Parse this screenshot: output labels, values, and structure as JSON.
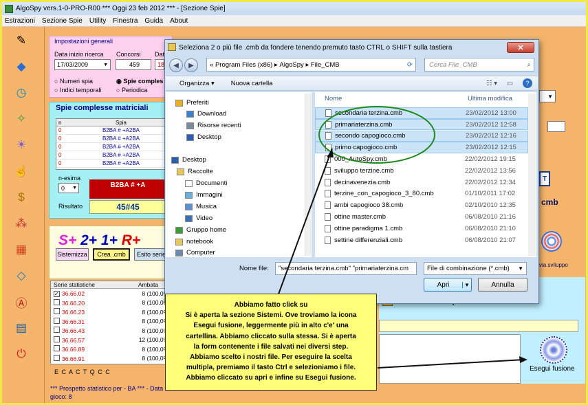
{
  "window": {
    "title": "AlgoSpy vers.1-0-PRO-R00  ***  Oggi 23 feb 2012  ***  - [Sezione Spie]"
  },
  "menu": [
    "Estrazioni",
    "Sezione Spie",
    "Utility",
    "Finestra",
    "Guida",
    "About"
  ],
  "toolbar_icons": [
    "pencil-icon",
    "book-icon",
    "clock-icon",
    "tag-icon",
    "bulb-icon",
    "hand-icon",
    "dollar-icon",
    "dots-icon",
    "calendar-icon",
    "diamond-icon",
    "a-icon",
    "notebook-icon",
    "power-icon"
  ],
  "settings": {
    "title": "Impostazioni generali",
    "date_label": "Data inizio ricerca",
    "date_value": "17/03/2009",
    "concorsi_label": "Concorsi",
    "concorsi_value": "459",
    "dat_label": "Dat",
    "dat_value": "18",
    "radio_numeri": "Numeri spia",
    "radio_spie": "Spie comples",
    "radio_indici": "Indici temporali",
    "radio_periodica": "Periodica"
  },
  "matrix": {
    "title": "Spie complesse matriciali",
    "col_n": "n",
    "col_spia": "Spia",
    "rows": [
      {
        "n": "0",
        "spia": "B2BA # +A2BA"
      },
      {
        "n": "0",
        "spia": "B2BA # +A2BA"
      },
      {
        "n": "0",
        "spia": "B2BA # +A2BA"
      },
      {
        "n": "0",
        "spia": "B2BA # +A2BA"
      },
      {
        "n": "0",
        "spia": "B2BA # +A2BA"
      }
    ],
    "nesima_label": "n-esima",
    "nesima_value": "0",
    "red_value": "B2BA # +A",
    "risultato_label": "Risultato",
    "risultato_value": "45#45"
  },
  "formula": {
    "s": "S+",
    "n2": "2+",
    "n1": "1+",
    "r": "R+"
  },
  "buttons": {
    "sistemizza": "Sistemizza",
    "crea": "Crea .cmb",
    "esito": "Esito serie"
  },
  "stats": {
    "col_serie": "Serie statistiche",
    "col_ambata": "Ambata",
    "rows": [
      {
        "serie": "36.66.02",
        "ambata": "8 (100,0%)",
        "checked": true
      },
      {
        "serie": "36.66.20",
        "ambata": "8 (100,0%)",
        "checked": false
      },
      {
        "serie": "36.66.23",
        "ambata": "8 (100,0%)",
        "checked": false
      },
      {
        "serie": "36.66.31",
        "ambata": "8 (100,0%)",
        "checked": false
      },
      {
        "serie": "36.66.43",
        "ambata": "8 (100,0%)",
        "checked": false
      },
      {
        "serie": "36.66.57",
        "ambata": "12 (100,0%)",
        "checked": false
      },
      {
        "serie": "36.66.89",
        "ambata": "8 (100,0%)",
        "checked": false
      },
      {
        "serie": "36.66.91",
        "ambata": "8 (100,0%)",
        "checked": false
      }
    ],
    "radios": "E C A C T Q C C",
    "footer1": "*** Prospetto statistico per  - BA ***  - Data i",
    "footer2": "gioco: 8"
  },
  "right": {
    "cmb_label": "cmb",
    "sviluppo_label": "via sviluppo",
    "multi_label": "Selezione multipla di file *.cmb",
    "esegui_label": "Esegui fusione"
  },
  "dialog": {
    "title": "Seleziona 2 o più file .cmb da fondere tenendo premuto tasto CTRL o SHIFT sulla tastiera",
    "path_prefix": "«",
    "path": [
      "Program Files (x86)",
      "AlgoSpy",
      "File_CMB"
    ],
    "search_placeholder": "Cerca File_CMB",
    "organizza": "Organizza",
    "nuova": "Nuova cartella",
    "nav_items": [
      "Preferiti",
      "Download",
      "Risorse recenti",
      "Desktop",
      "Desktop",
      "Raccolte",
      "Documenti",
      "Immagini",
      "Musica",
      "Video",
      "Gruppo home",
      "notebook",
      "Computer"
    ],
    "col_nome": "Nome",
    "col_data": "Ultima modifica",
    "files": [
      {
        "name": "secondaria terzina.cmb",
        "date": "23/02/2012 13:00",
        "sel": true
      },
      {
        "name": "primariaterzina.cmb",
        "date": "23/02/2012 12:58",
        "sel": true
      },
      {
        "name": "secondo capogioco.cmb",
        "date": "23/02/2012 12:16",
        "sel": true
      },
      {
        "name": "primo capogioco.cmb",
        "date": "23/02/2012 12:15",
        "sel": true
      },
      {
        "name": "000_AutoSpy.cmb",
        "date": "22/02/2012 19:15",
        "sel": false
      },
      {
        "name": "sviluppo terzine.cmb",
        "date": "22/02/2012 13:56",
        "sel": false
      },
      {
        "name": "decinavenezia.cmb",
        "date": "22/02/2012 12:34",
        "sel": false
      },
      {
        "name": "terzine_con_capogioco_3_80.cmb",
        "date": "01/10/2011 17:02",
        "sel": false
      },
      {
        "name": "ambi capogioco 38.cmb",
        "date": "02/10/2010 12:35",
        "sel": false
      },
      {
        "name": "ottine master.cmb",
        "date": "06/08/2010 21:16",
        "sel": false
      },
      {
        "name": "ottine paradigma 1.cmb",
        "date": "06/08/2010 21:10",
        "sel": false
      },
      {
        "name": "settine differenziali.cmb",
        "date": "06/08/2010 21:07",
        "sel": false
      }
    ],
    "filename_label": "Nome file:",
    "filename_value": "\"secondaria terzina.cmb\" \"primariaterzina.cm",
    "filetype_value": "File di combinazione (*.cmb)",
    "apri": "Apri",
    "annulla": "Annulla"
  },
  "note": {
    "lines": [
      "Abbiamo fatto click su",
      "Si è aperta la sezione Sistemi. Ove troviamo la icona",
      "Esegui fusione, leggermente più in alto c'e' una",
      "cartellina. Abbiamo cliccato sulla stessa. Si è aperta",
      "la form contenente i file salvati nei diversi step.",
      "Abbiamo scelto i nostri file. Per eseguire la scelta",
      "multipla, premiamo il tasto Ctrl e selezioniamo i file.",
      "Abbiamo cliccato su apri e infine su Esegui fusione."
    ]
  }
}
